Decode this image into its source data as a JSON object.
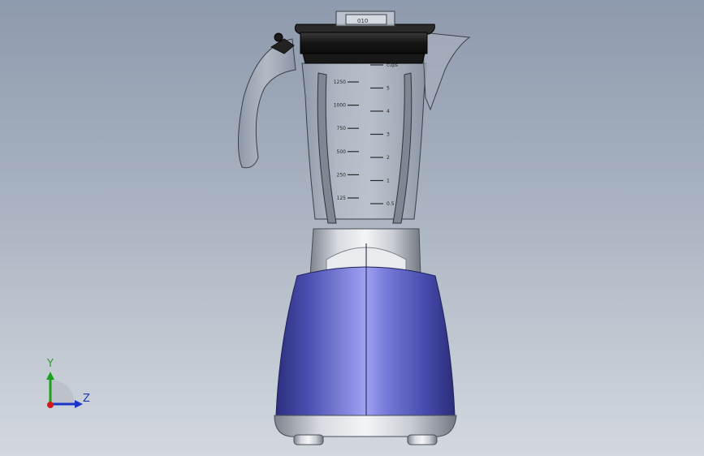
{
  "viewport": {
    "background_top": "#8e9aad",
    "background_bottom": "#d3d8de"
  },
  "model": {
    "lid_cap_label": "010",
    "left_scale": [
      "1250",
      "1000",
      "750",
      "500",
      "250",
      "125"
    ],
    "right_scale": [
      "cups",
      "5",
      "4",
      "3",
      "2",
      "1",
      "0.5"
    ],
    "colors": {
      "base_body": "#5b5fc4",
      "base_chrome": "#c9ccd2",
      "lid": "#1e1e1e",
      "jar": "#9ea6b3"
    }
  },
  "triad": {
    "y_label": "Y",
    "z_label": "Z",
    "x_color": "#d11b1b",
    "y_color": "#1da01d",
    "z_color": "#1a36c8"
  }
}
